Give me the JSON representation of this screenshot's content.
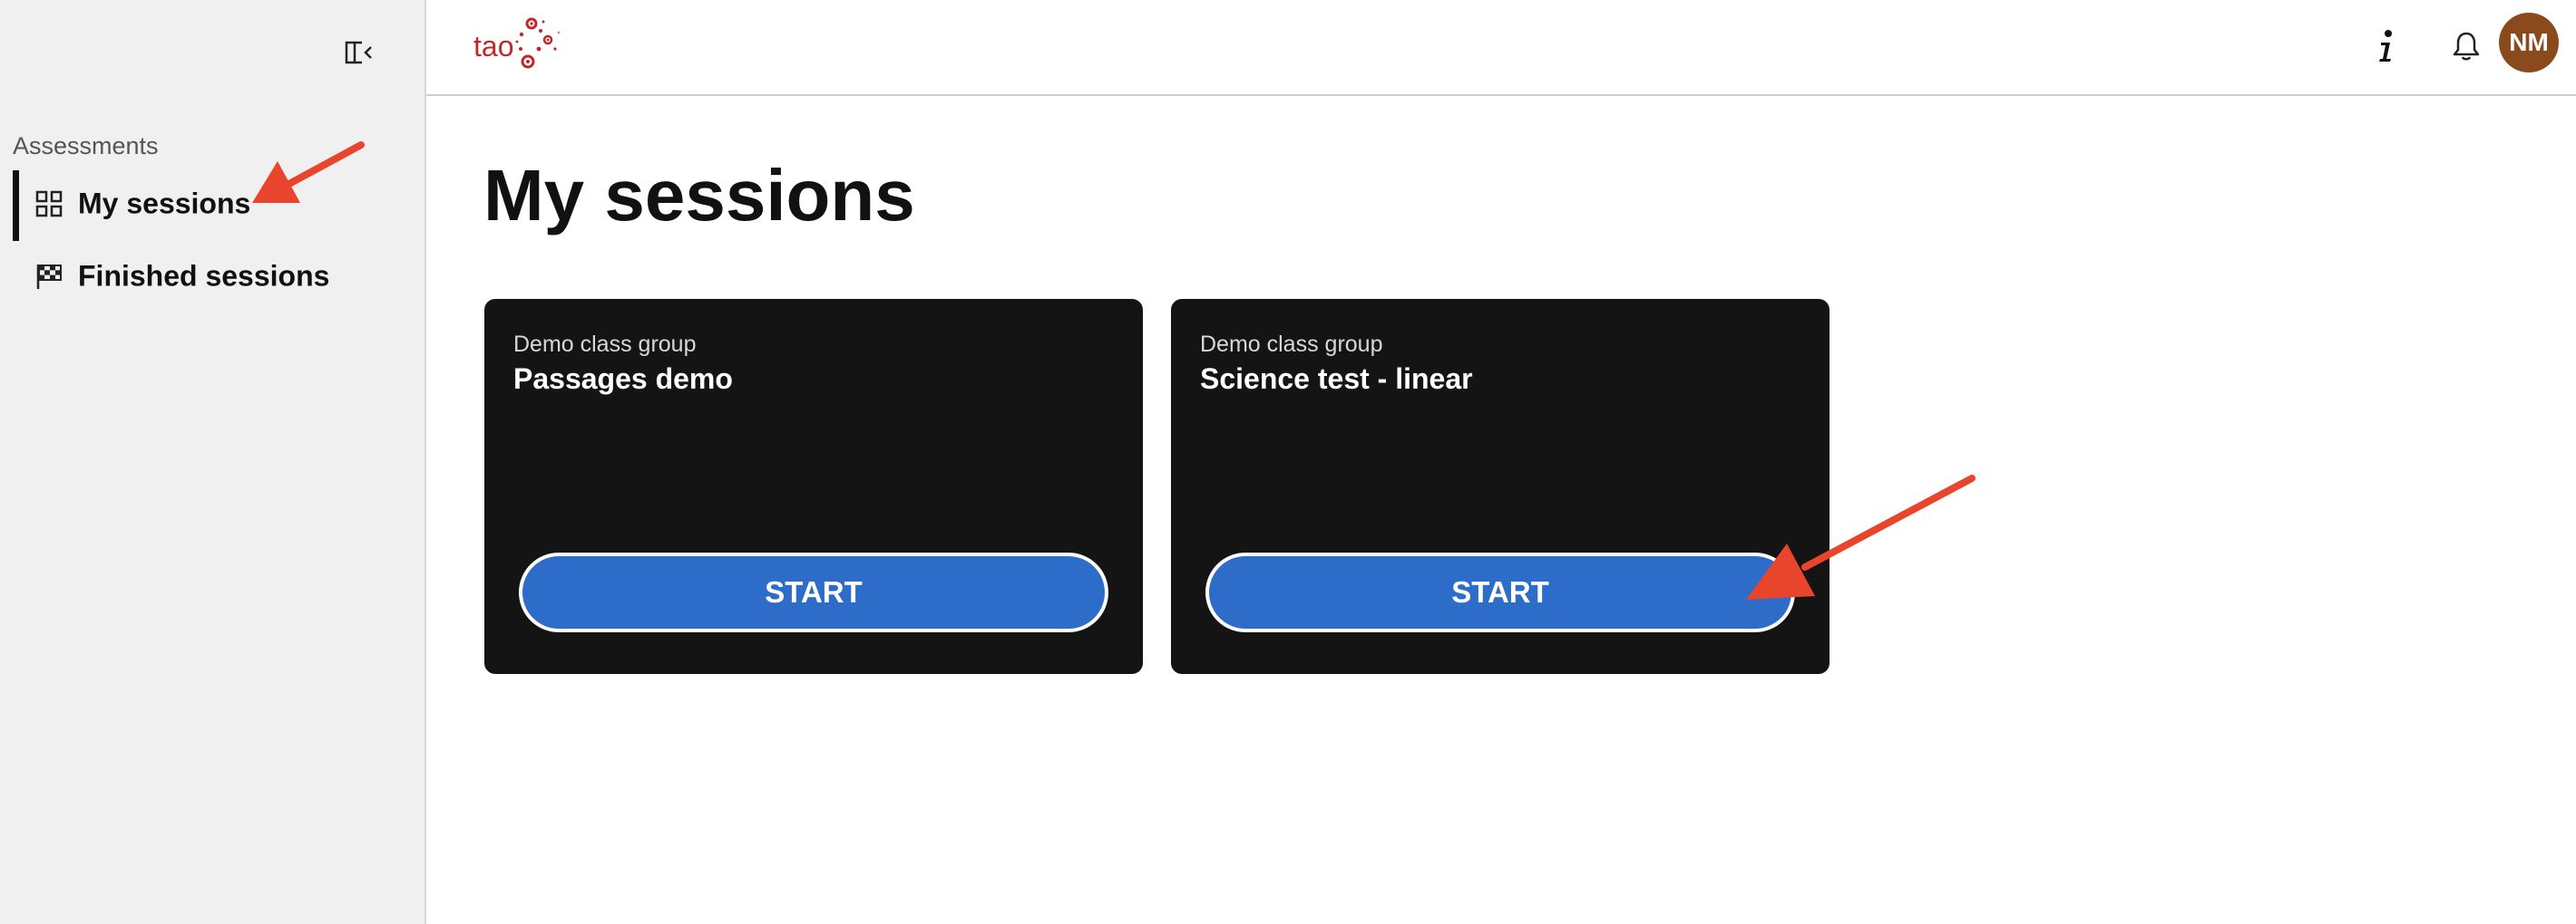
{
  "sidebar": {
    "collapse_icon": "sidebar-collapse-icon",
    "section_label": "Assessments",
    "items": [
      {
        "label": "My sessions",
        "icon": "grid-icon",
        "active": true
      },
      {
        "label": "Finished sessions",
        "icon": "checkered-flag-icon",
        "active": false
      }
    ]
  },
  "header": {
    "logo_text": "tao",
    "logo_color": "#c0282a",
    "info_icon": "info-icon",
    "notifications_icon": "bell-icon",
    "avatar": {
      "initials": "NM",
      "color": "#8a4a1c"
    }
  },
  "main": {
    "title": "My sessions",
    "cards": [
      {
        "group": "Demo class group",
        "title": "Passages demo",
        "button": "START"
      },
      {
        "group": "Demo class group",
        "title": "Science test - linear",
        "button": "START"
      }
    ]
  },
  "colors": {
    "card_bg": "#141414",
    "button_blue": "#2e6cc9",
    "annotation_arrow": "#e8452c"
  }
}
